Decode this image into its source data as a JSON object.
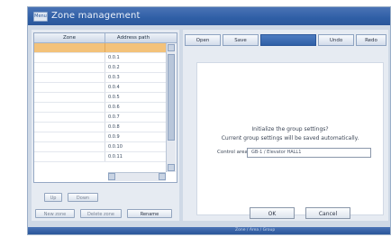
{
  "window": {
    "menu_label": "Menu",
    "title": "Zone management"
  },
  "grid": {
    "columns": [
      "Zone",
      "Address path"
    ],
    "rows": [
      {
        "address": ""
      },
      {
        "address": "0.0.1"
      },
      {
        "address": "0.0.2"
      },
      {
        "address": "0.0.3"
      },
      {
        "address": "0.0.4"
      },
      {
        "address": "0.0.5"
      },
      {
        "address": "0.0.6"
      },
      {
        "address": "0.0.7"
      },
      {
        "address": "0.0.8"
      },
      {
        "address": "0.0.9"
      },
      {
        "address": "0.0.10"
      },
      {
        "address": "0.0.11"
      }
    ]
  },
  "left_buttons": {
    "up": "Up",
    "down": "Down",
    "new_zone": "New zone",
    "delete_zone": "Delete zone",
    "rename": "Rename"
  },
  "toolbar": {
    "items": [
      "Open",
      "Save",
      "",
      "Undo",
      "Redo"
    ]
  },
  "dialog": {
    "question": "Initialize the group settings?",
    "note": "Current group settings will be saved automatically.",
    "config_label": "Control area",
    "config_value": "GB-1 / Elevator HALL1",
    "ok": "OK",
    "cancel": "Cancel"
  },
  "status": {
    "text": "Zone / Area / Group"
  },
  "colors": {
    "accent": "#2f5fa6",
    "selection": "#f3c27a",
    "panel": "#e6ebf2"
  }
}
